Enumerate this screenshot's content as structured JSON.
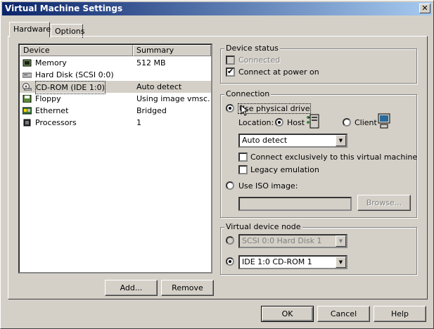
{
  "window": {
    "title": "Virtual Machine Settings",
    "close_icon": "✕"
  },
  "tabs": [
    {
      "label": "Hardware"
    },
    {
      "label": "Options"
    }
  ],
  "device_list": {
    "headers": {
      "device": "Device",
      "summary": "Summary"
    },
    "rows": [
      {
        "icon": "memory-icon",
        "device": "Memory",
        "summary": "512 MB"
      },
      {
        "icon": "hard-disk-icon",
        "device": "Hard Disk (SCSI 0:0)",
        "summary": ""
      },
      {
        "icon": "cdrom-icon",
        "device": "CD-ROM (IDE 1:0)",
        "summary": "Auto detect"
      },
      {
        "icon": "floppy-icon",
        "device": "Floppy",
        "summary": "Using image vmsc..."
      },
      {
        "icon": "ethernet-icon",
        "device": "Ethernet",
        "summary": "Bridged"
      },
      {
        "icon": "processor-icon",
        "device": "Processors",
        "summary": "1"
      }
    ],
    "selected_index": 2
  },
  "buttons": {
    "add": "Add...",
    "remove": "Remove",
    "ok": "OK",
    "cancel": "Cancel",
    "help": "Help",
    "browse": "Browse..."
  },
  "device_status": {
    "label": "Device status",
    "connected": "Connected",
    "connect_at_power_on": "Connect at power on"
  },
  "connection": {
    "label": "Connection",
    "use_physical_drive": "Use physical drive",
    "location_label": "Location:",
    "host": "Host",
    "client": "Client",
    "drive_select": "Auto detect",
    "connect_exclusively": "Connect exclusively to this virtual machine",
    "legacy_emulation": "Legacy emulation",
    "use_iso_image": "Use ISO image:",
    "iso_path": ""
  },
  "virtual_device_node": {
    "label": "Virtual device node",
    "scsi_select": "SCSI 0:0  Hard Disk 1",
    "ide_select": "IDE 1:0  CD-ROM 1"
  }
}
